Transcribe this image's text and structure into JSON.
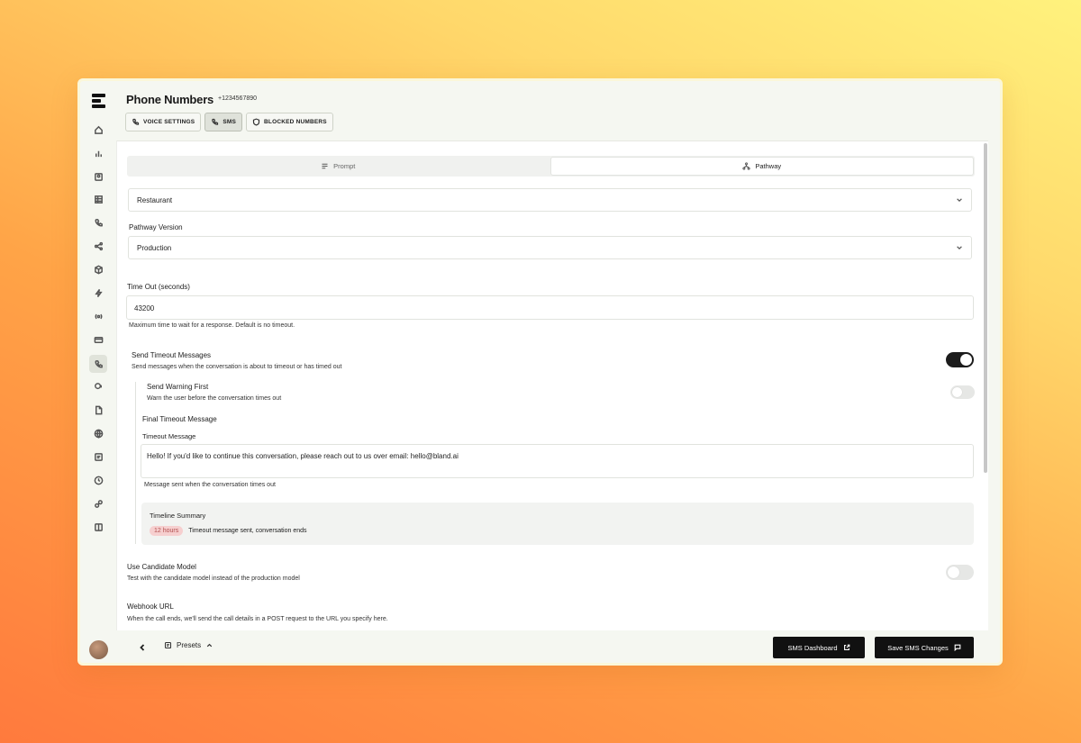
{
  "header": {
    "title": "Phone Numbers",
    "phone_number": "+1234567890",
    "tabs": [
      {
        "label": "VOICE SETTINGS",
        "icon": "phone-icon"
      },
      {
        "label": "SMS",
        "icon": "phone-icon",
        "active": true
      },
      {
        "label": "BLOCKED NUMBERS",
        "icon": "shield-icon"
      }
    ]
  },
  "mode_switch": {
    "options": [
      {
        "label": "Prompt",
        "icon": "list-icon"
      },
      {
        "label": "Pathway",
        "icon": "pathway-icon",
        "active": true
      }
    ]
  },
  "form": {
    "pathway": {
      "value": "Restaurant"
    },
    "pathway_version": {
      "label": "Pathway Version",
      "value": "Production"
    },
    "timeout": {
      "label": "Time Out (seconds)",
      "value": "43200",
      "help": "Maximum time to wait for a response. Default is no timeout."
    },
    "send_timeout_messages": {
      "label": "Send Timeout Messages",
      "help": "Send messages when the conversation is about to timeout or has timed out",
      "enabled": true
    },
    "send_warning_first": {
      "label": "Send Warning First",
      "help": "Warn the user before the conversation times out",
      "enabled": false
    },
    "final_timeout_message": {
      "heading": "Final Timeout Message",
      "label": "Timeout Message",
      "value": "Hello! If you'd like to continue this conversation, please reach out to us over email: hello@bland.ai",
      "help": "Message sent when the conversation times out"
    },
    "timeline_summary": {
      "heading": "Timeline Summary",
      "badge": "12 hours",
      "text": "Timeout message sent, conversation ends"
    },
    "use_candidate_model": {
      "label": "Use Candidate Model",
      "help": "Test with the candidate model instead of the production model",
      "enabled": false
    },
    "webhook": {
      "label": "Webhook URL",
      "help": "When the call ends, we'll send the call details in a POST request to the URL you specify here."
    }
  },
  "footer": {
    "presets_label": "Presets",
    "dashboard_button": "SMS Dashboard",
    "save_button": "Save SMS Changes"
  },
  "colors": {
    "accent_dark": "#111111",
    "badge_bg": "#f6cfcf",
    "badge_text": "#b25050"
  }
}
